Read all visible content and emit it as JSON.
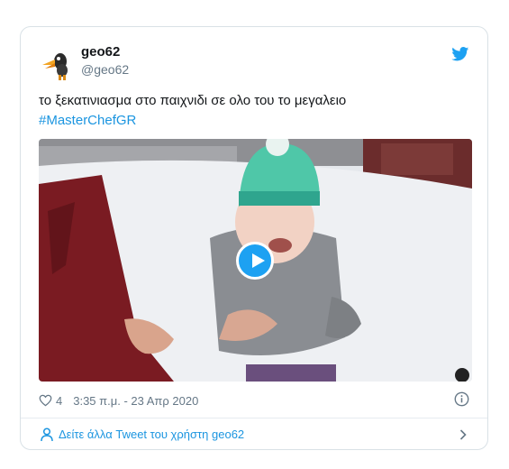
{
  "tweet": {
    "author_name": "geo62",
    "author_handle": "@geo62",
    "text": "το ξεκατινιασμα στο παιχνιδι σε ολο του το μεγαλειο",
    "hashtag": "#MasterChefGR",
    "likes": "4",
    "timestamp": "3:35 π.μ. - 23 Απρ 2020"
  },
  "footer": {
    "more_tweets_label": "Δείτε άλλα Tweet του χρήστη geo62"
  },
  "colors": {
    "accent": "#1b95e0",
    "play_button": "#1da1f2",
    "muted_text": "#657786"
  },
  "icons": [
    "twitter-bird-icon",
    "play-icon",
    "heart-icon",
    "info-icon",
    "user-icon",
    "chevron-right-icon"
  ]
}
